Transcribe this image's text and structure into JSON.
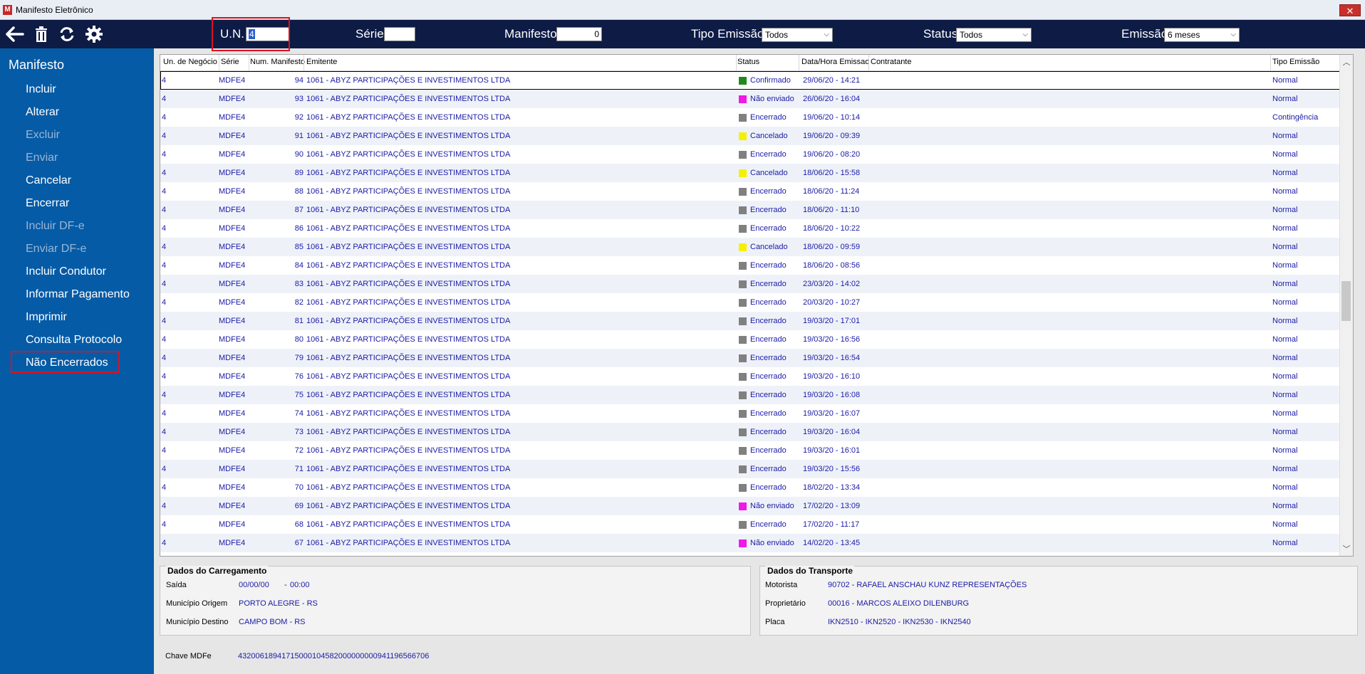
{
  "window": {
    "title": "Manifesto Eletrônico",
    "close": "✕"
  },
  "toolbar": {
    "un_label": "U.N.",
    "un_value": "4",
    "serie_label": "Série",
    "serie_value": "",
    "manifesto_label": "Manifesto",
    "manifesto_value": "0",
    "tipo_label": "Tipo Emissão",
    "tipo_value": "Todos",
    "status_label": "Status",
    "status_value": "Todos",
    "emissao_label": "Emissão",
    "emissao_value": "6 meses"
  },
  "sidebar": {
    "header": "Manifesto",
    "items": [
      {
        "label": "Incluir",
        "enabled": true
      },
      {
        "label": "Alterar",
        "enabled": true
      },
      {
        "label": "Excluir",
        "enabled": false
      },
      {
        "label": "Enviar",
        "enabled": false
      },
      {
        "label": "Cancelar",
        "enabled": true
      },
      {
        "label": "Encerrar",
        "enabled": true
      },
      {
        "label": "Incluir DF-e",
        "enabled": false
      },
      {
        "label": "Enviar DF-e",
        "enabled": false
      },
      {
        "label": "Incluir Condutor",
        "enabled": true
      },
      {
        "label": "Informar Pagamento",
        "enabled": true
      },
      {
        "label": "Imprimir",
        "enabled": true
      },
      {
        "label": "Consulta Protocolo",
        "enabled": true
      },
      {
        "label": "Não Encerrados",
        "enabled": true
      }
    ]
  },
  "grid": {
    "columns": {
      "un": "Un. de Negócio",
      "serie": "Série",
      "num": "Num. Manifesto",
      "emitente": "Emitente",
      "status": "Status",
      "data": "Data/Hora Emissao",
      "contratante": "Contratante",
      "tipo": "Tipo Emissão"
    },
    "status_colors": {
      "Confirmado": "#1e8a1e",
      "Não enviado": "#f018e8",
      "Encerrado": "#808080",
      "Cancelado": "#f5f000"
    },
    "rows": [
      {
        "un": "4",
        "serie": "MDFE4",
        "num": "94",
        "emitente": "1061 - ABYZ PARTICIPAÇÕES E INVESTIMENTOS LTDA",
        "status": "Confirmado",
        "data": "29/06/20 - 14:21",
        "contratante": "",
        "tipo": "Normal"
      },
      {
        "un": "4",
        "serie": "MDFE4",
        "num": "93",
        "emitente": "1061 - ABYZ PARTICIPAÇÕES E INVESTIMENTOS LTDA",
        "status": "Não enviado",
        "data": "26/06/20 - 16:04",
        "contratante": "",
        "tipo": "Normal"
      },
      {
        "un": "4",
        "serie": "MDFE4",
        "num": "92",
        "emitente": "1061 - ABYZ PARTICIPAÇÕES E INVESTIMENTOS LTDA",
        "status": "Encerrado",
        "data": "19/06/20 - 10:14",
        "contratante": "",
        "tipo": "Contingência"
      },
      {
        "un": "4",
        "serie": "MDFE4",
        "num": "91",
        "emitente": "1061 - ABYZ PARTICIPAÇÕES E INVESTIMENTOS LTDA",
        "status": "Cancelado",
        "data": "19/06/20 - 09:39",
        "contratante": "",
        "tipo": "Normal"
      },
      {
        "un": "4",
        "serie": "MDFE4",
        "num": "90",
        "emitente": "1061 - ABYZ PARTICIPAÇÕES E INVESTIMENTOS LTDA",
        "status": "Encerrado",
        "data": "19/06/20 - 08:20",
        "contratante": "",
        "tipo": "Normal"
      },
      {
        "un": "4",
        "serie": "MDFE4",
        "num": "89",
        "emitente": "1061 - ABYZ PARTICIPAÇÕES E INVESTIMENTOS LTDA",
        "status": "Cancelado",
        "data": "18/06/20 - 15:58",
        "contratante": "",
        "tipo": "Normal"
      },
      {
        "un": "4",
        "serie": "MDFE4",
        "num": "88",
        "emitente": "1061 - ABYZ PARTICIPAÇÕES E INVESTIMENTOS LTDA",
        "status": "Encerrado",
        "data": "18/06/20 - 11:24",
        "contratante": "",
        "tipo": "Normal"
      },
      {
        "un": "4",
        "serie": "MDFE4",
        "num": "87",
        "emitente": "1061 - ABYZ PARTICIPAÇÕES E INVESTIMENTOS LTDA",
        "status": "Encerrado",
        "data": "18/06/20 - 11:10",
        "contratante": "",
        "tipo": "Normal"
      },
      {
        "un": "4",
        "serie": "MDFE4",
        "num": "86",
        "emitente": "1061 - ABYZ PARTICIPAÇÕES E INVESTIMENTOS LTDA",
        "status": "Encerrado",
        "data": "18/06/20 - 10:22",
        "contratante": "",
        "tipo": "Normal"
      },
      {
        "un": "4",
        "serie": "MDFE4",
        "num": "85",
        "emitente": "1061 - ABYZ PARTICIPAÇÕES E INVESTIMENTOS LTDA",
        "status": "Cancelado",
        "data": "18/06/20 - 09:59",
        "contratante": "",
        "tipo": "Normal"
      },
      {
        "un": "4",
        "serie": "MDFE4",
        "num": "84",
        "emitente": "1061 - ABYZ PARTICIPAÇÕES E INVESTIMENTOS LTDA",
        "status": "Encerrado",
        "data": "18/06/20 - 08:56",
        "contratante": "",
        "tipo": "Normal"
      },
      {
        "un": "4",
        "serie": "MDFE4",
        "num": "83",
        "emitente": "1061 - ABYZ PARTICIPAÇÕES E INVESTIMENTOS LTDA",
        "status": "Encerrado",
        "data": "23/03/20 - 14:02",
        "contratante": "",
        "tipo": "Normal"
      },
      {
        "un": "4",
        "serie": "MDFE4",
        "num": "82",
        "emitente": "1061 - ABYZ PARTICIPAÇÕES E INVESTIMENTOS LTDA",
        "status": "Encerrado",
        "data": "20/03/20 - 10:27",
        "contratante": "",
        "tipo": "Normal"
      },
      {
        "un": "4",
        "serie": "MDFE4",
        "num": "81",
        "emitente": "1061 - ABYZ PARTICIPAÇÕES E INVESTIMENTOS LTDA",
        "status": "Encerrado",
        "data": "19/03/20 - 17:01",
        "contratante": "",
        "tipo": "Normal"
      },
      {
        "un": "4",
        "serie": "MDFE4",
        "num": "80",
        "emitente": "1061 - ABYZ PARTICIPAÇÕES E INVESTIMENTOS LTDA",
        "status": "Encerrado",
        "data": "19/03/20 - 16:56",
        "contratante": "",
        "tipo": "Normal"
      },
      {
        "un": "4",
        "serie": "MDFE4",
        "num": "79",
        "emitente": "1061 - ABYZ PARTICIPAÇÕES E INVESTIMENTOS LTDA",
        "status": "Encerrado",
        "data": "19/03/20 - 16:54",
        "contratante": "",
        "tipo": "Normal"
      },
      {
        "un": "4",
        "serie": "MDFE4",
        "num": "76",
        "emitente": "1061 - ABYZ PARTICIPAÇÕES E INVESTIMENTOS LTDA",
        "status": "Encerrado",
        "data": "19/03/20 - 16:10",
        "contratante": "",
        "tipo": "Normal"
      },
      {
        "un": "4",
        "serie": "MDFE4",
        "num": "75",
        "emitente": "1061 - ABYZ PARTICIPAÇÕES E INVESTIMENTOS LTDA",
        "status": "Encerrado",
        "data": "19/03/20 - 16:08",
        "contratante": "",
        "tipo": "Normal"
      },
      {
        "un": "4",
        "serie": "MDFE4",
        "num": "74",
        "emitente": "1061 - ABYZ PARTICIPAÇÕES E INVESTIMENTOS LTDA",
        "status": "Encerrado",
        "data": "19/03/20 - 16:07",
        "contratante": "",
        "tipo": "Normal"
      },
      {
        "un": "4",
        "serie": "MDFE4",
        "num": "73",
        "emitente": "1061 - ABYZ PARTICIPAÇÕES E INVESTIMENTOS LTDA",
        "status": "Encerrado",
        "data": "19/03/20 - 16:04",
        "contratante": "",
        "tipo": "Normal"
      },
      {
        "un": "4",
        "serie": "MDFE4",
        "num": "72",
        "emitente": "1061 - ABYZ PARTICIPAÇÕES E INVESTIMENTOS LTDA",
        "status": "Encerrado",
        "data": "19/03/20 - 16:01",
        "contratante": "",
        "tipo": "Normal"
      },
      {
        "un": "4",
        "serie": "MDFE4",
        "num": "71",
        "emitente": "1061 - ABYZ PARTICIPAÇÕES E INVESTIMENTOS LTDA",
        "status": "Encerrado",
        "data": "19/03/20 - 15:56",
        "contratante": "",
        "tipo": "Normal"
      },
      {
        "un": "4",
        "serie": "MDFE4",
        "num": "70",
        "emitente": "1061 - ABYZ PARTICIPAÇÕES E INVESTIMENTOS LTDA",
        "status": "Encerrado",
        "data": "18/02/20 - 13:34",
        "contratante": "",
        "tipo": "Normal"
      },
      {
        "un": "4",
        "serie": "MDFE4",
        "num": "69",
        "emitente": "1061 - ABYZ PARTICIPAÇÕES E INVESTIMENTOS LTDA",
        "status": "Não enviado",
        "data": "17/02/20 - 13:09",
        "contratante": "",
        "tipo": "Normal"
      },
      {
        "un": "4",
        "serie": "MDFE4",
        "num": "68",
        "emitente": "1061 - ABYZ PARTICIPAÇÕES E INVESTIMENTOS LTDA",
        "status": "Encerrado",
        "data": "17/02/20 - 11:17",
        "contratante": "",
        "tipo": "Normal"
      },
      {
        "un": "4",
        "serie": "MDFE4",
        "num": "67",
        "emitente": "1061 - ABYZ PARTICIPAÇÕES E INVESTIMENTOS LTDA",
        "status": "Não enviado",
        "data": "14/02/20 - 13:45",
        "contratante": "",
        "tipo": "Normal"
      }
    ]
  },
  "carregamento": {
    "title": "Dados do Carregamento",
    "saida_label": "Saída",
    "saida_date": "00/00/00",
    "saida_sep": "-",
    "saida_time": "00:00",
    "origem_label": "Município Origem",
    "origem_value": "PORTO ALEGRE - RS",
    "destino_label": "Município Destino",
    "destino_value": "CAMPO BOM - RS"
  },
  "transporte": {
    "title": "Dados do Transporte",
    "motorista_label": "Motorista",
    "motorista_value": "90702 - RAFAEL ANSCHAU KUNZ REPRESENTAÇÕES",
    "proprietario_label": "Proprietário",
    "proprietario_value": "00016 - MARCOS ALEIXO DILENBURG",
    "placa_label": "Placa",
    "placa_value": "IKN2510 - IKN2520 - IKN2530 - IKN2540"
  },
  "chave": {
    "label": "Chave MDFe",
    "value": "43200618941715000104582000000000941196566706"
  }
}
